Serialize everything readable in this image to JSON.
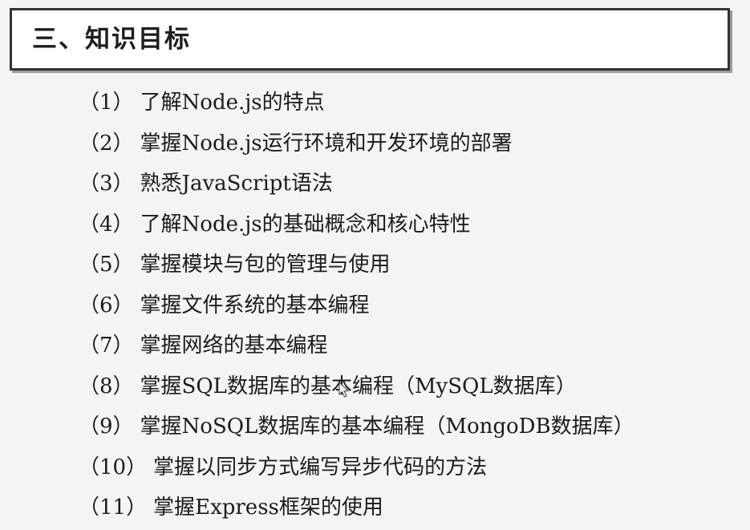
{
  "title": "三、知识目标",
  "goals": [
    {
      "num": "（1）",
      "text": "了解Node.js的特点"
    },
    {
      "num": "（2）",
      "text": "掌握Node.js运行环境和开发环境的部署"
    },
    {
      "num": "（3）",
      "text": "熟悉JavaScript语法"
    },
    {
      "num": "（4）",
      "text": "了解Node.js的基础概念和核心特性"
    },
    {
      "num": "（5）",
      "text": "掌握模块与包的管理与使用"
    },
    {
      "num": "（6）",
      "text": "掌握文件系统的基本编程"
    },
    {
      "num": "（7）",
      "text": "掌握网络的基本编程"
    },
    {
      "num": "（8）",
      "text": "掌握SQL数据库的基本编程（MySQL数据库）"
    },
    {
      "num": "（9）",
      "text": "掌握NoSQL数据库的基本编程（MongoDB数据库）"
    },
    {
      "num": "（10）",
      "text": "掌握以同步方式编写异步代码的方法"
    },
    {
      "num": "（11）",
      "text": "掌握Express框架的使用"
    }
  ],
  "icons": {
    "cursor": "mouse-pointer-icon"
  }
}
